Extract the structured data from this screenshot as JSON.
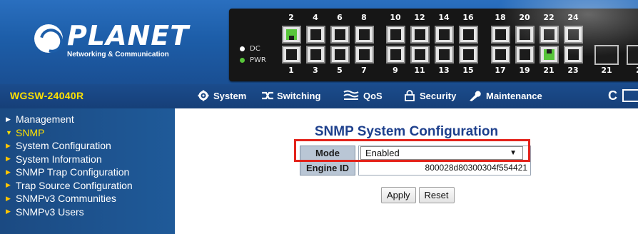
{
  "brand": {
    "logo_name": "PLANET",
    "logo_subtitle": "Networking & Communication"
  },
  "device_panel": {
    "led_labels": [
      "DC",
      "PWR"
    ],
    "top_port_numbers": [
      "2",
      "4",
      "6",
      "8",
      "10",
      "12",
      "14",
      "16",
      "18",
      "20",
      "22",
      "24"
    ],
    "bottom_port_numbers": [
      "1",
      "3",
      "5",
      "7",
      "9",
      "11",
      "13",
      "15",
      "17",
      "19",
      "21",
      "23"
    ],
    "sfp_port_numbers": [
      "21",
      "2"
    ],
    "active_ports": [
      "2",
      "21"
    ],
    "colors": {
      "port_active": "#58c53a",
      "led_dc": "#ffffff",
      "led_pwr": "#58c53a"
    }
  },
  "navbar": {
    "model": "WGSW-24040R",
    "items": [
      {
        "label": "System",
        "icon": "gear-icon"
      },
      {
        "label": "Switching",
        "icon": "switching-icon"
      },
      {
        "label": "QoS",
        "icon": "qos-icon"
      },
      {
        "label": "Security",
        "icon": "lock-icon"
      },
      {
        "label": "Maintenance",
        "icon": "wrench-icon"
      }
    ],
    "refresh_icon": "C"
  },
  "sidebar": {
    "items": [
      {
        "label": "Management",
        "state": "collapsed"
      },
      {
        "label": "SNMP",
        "state": "expanded"
      },
      {
        "label": "System Configuration",
        "state": "sub"
      },
      {
        "label": "System Information",
        "state": "sub"
      },
      {
        "label": "SNMP Trap Configuration",
        "state": "sub"
      },
      {
        "label": "Trap Source Configuration",
        "state": "sub"
      },
      {
        "label": "SNMPv3 Communities",
        "state": "sub"
      },
      {
        "label": "SNMPv3 Users",
        "state": "sub"
      }
    ]
  },
  "main": {
    "title": "SNMP System Configuration",
    "fields": {
      "mode_label": "Mode",
      "mode_value": "Enabled",
      "engine_id_label": "Engine ID",
      "engine_id_value": "800028d80300304f554421"
    },
    "buttons": {
      "apply": "Apply",
      "reset": "Reset"
    },
    "colors": {
      "title": "#1d3f8c",
      "highlight": "#e3231b"
    }
  }
}
